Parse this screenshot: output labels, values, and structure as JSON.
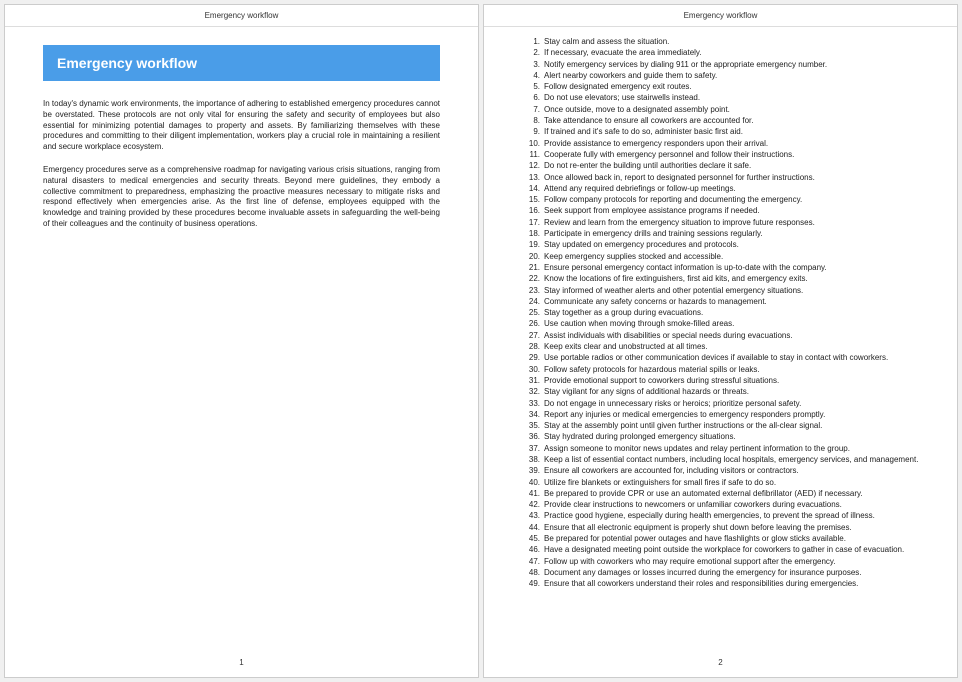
{
  "document": {
    "header_title": "Emergency workflow",
    "main_title": "Emergency workflow",
    "paragraphs": [
      "In today's dynamic work environments, the importance of adhering to established emergency procedures cannot be overstated. These protocols are not only vital for ensuring the safety and security of employees but also essential for minimizing potential damages to property and assets. By familiarizing themselves with these procedures and committing to their diligent implementation, workers play a crucial role in maintaining a resilient and secure workplace ecosystem.",
      "Emergency procedures serve as a comprehensive roadmap for navigating various crisis situations, ranging from natural disasters to medical emergencies and security threats. Beyond mere guidelines, they embody a collective commitment to preparedness, emphasizing the proactive measures necessary to mitigate risks and respond effectively when emergencies arise. As the first line of defense, employees equipped with the knowledge and training provided by these procedures become invaluable assets in safeguarding the well-being of their colleagues and the continuity of business operations."
    ],
    "steps": [
      "Stay calm and assess the situation.",
      "If necessary, evacuate the area immediately.",
      "Notify emergency services by dialing 911 or the appropriate emergency number.",
      "Alert nearby coworkers and guide them to safety.",
      "Follow designated emergency exit routes.",
      "Do not use elevators; use stairwells instead.",
      "Once outside, move to a designated assembly point.",
      "Take attendance to ensure all coworkers are accounted for.",
      "If trained and it's safe to do so, administer basic first aid.",
      "Provide assistance to emergency responders upon their arrival.",
      "Cooperate fully with emergency personnel and follow their instructions.",
      "Do not re-enter the building until authorities declare it safe.",
      "Once allowed back in, report to designated personnel for further instructions.",
      "Attend any required debriefings or follow-up meetings.",
      "Follow company protocols for reporting and documenting the emergency.",
      "Seek support from employee assistance programs if needed.",
      "Review and learn from the emergency situation to improve future responses.",
      "Participate in emergency drills and training sessions regularly.",
      "Stay updated on emergency procedures and protocols.",
      "Keep emergency supplies stocked and accessible.",
      "Ensure personal emergency contact information is up-to-date with the company.",
      "Know the locations of fire extinguishers, first aid kits, and emergency exits.",
      "Stay informed of weather alerts and other potential emergency situations.",
      "Communicate any safety concerns or hazards to management.",
      "Stay together as a group during evacuations.",
      "Use caution when moving through smoke-filled areas.",
      "Assist individuals with disabilities or special needs during evacuations.",
      "Keep exits clear and unobstructed at all times.",
      "Use portable radios or other communication devices if available to stay in contact with coworkers.",
      "Follow safety protocols for hazardous material spills or leaks.",
      "Provide emotional support to coworkers during stressful situations.",
      "Stay vigilant for any signs of additional hazards or threats.",
      "Do not engage in unnecessary risks or heroics; prioritize personal safety.",
      "Report any injuries or medical emergencies to emergency responders promptly.",
      "Stay at the assembly point until given further instructions or the all-clear signal.",
      "Stay hydrated during prolonged emergency situations.",
      "Assign someone to monitor news updates and relay pertinent information to the group.",
      "Keep a list of essential contact numbers, including local hospitals, emergency services, and management.",
      "Ensure all coworkers are accounted for, including visitors or contractors.",
      "Utilize fire blankets or extinguishers for small fires if safe to do so.",
      "Be prepared to provide CPR or use an automated external defibrillator (AED) if necessary.",
      "Provide clear instructions to newcomers or unfamiliar coworkers during evacuations.",
      "Practice good hygiene, especially during health emergencies, to prevent the spread of illness.",
      "Ensure that all electronic equipment is properly shut down before leaving the premises.",
      "Be prepared for potential power outages and have flashlights or glow sticks available.",
      "Have a designated meeting point outside the workplace for coworkers to gather in case of evacuation.",
      "Follow up with coworkers who may require emotional support after the emergency.",
      "Document any damages or losses incurred during the emergency for insurance purposes.",
      "Ensure that all coworkers understand their roles and responsibilities during emergencies."
    ],
    "page_numbers": [
      "1",
      "2"
    ]
  }
}
